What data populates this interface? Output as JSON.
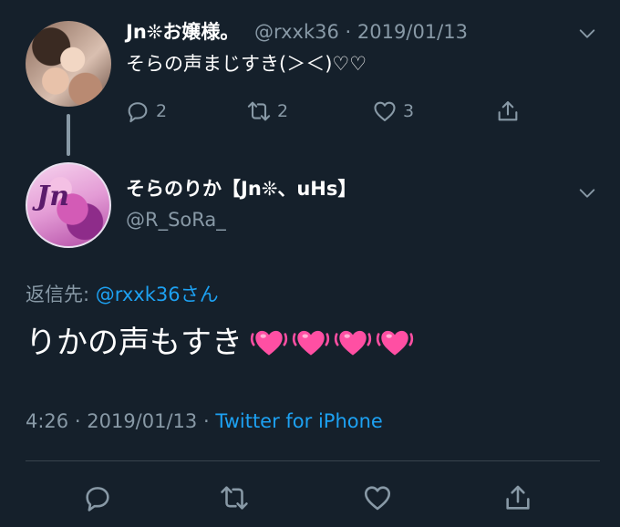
{
  "parent_tweet": {
    "display_name": "Jn❊お嬢様。",
    "handle": "@rxxk36",
    "separator": "·",
    "date": "2019/01/13",
    "text": "そらの声まじすき(＞＜)♡♡",
    "actions": {
      "reply_count": "2",
      "retweet_count": "2",
      "like_count": "3"
    },
    "icons": {
      "reply": "reply-icon",
      "retweet": "retweet-icon",
      "like": "heart-icon",
      "share": "share-icon",
      "menu": "chevron-down-icon"
    }
  },
  "reply_tweet": {
    "display_name": "そらのりか【Jn❊、uHs】",
    "handle": "@R_SoRa_",
    "replying_to_label": "返信先:",
    "replying_to_user": "@rxxk36さん",
    "text": "りかの声もすき",
    "emoji_count": 4,
    "emoji_name": "beating-heart",
    "time": "4:26",
    "separator": "·",
    "date": "2019/01/13",
    "separator2": "·",
    "source": "Twitter for iPhone"
  },
  "colors": {
    "background": "#15202b",
    "muted": "#8899a6",
    "link": "#1da1f2",
    "divider": "#38444d",
    "heart_emoji": "#ff4fa3"
  }
}
